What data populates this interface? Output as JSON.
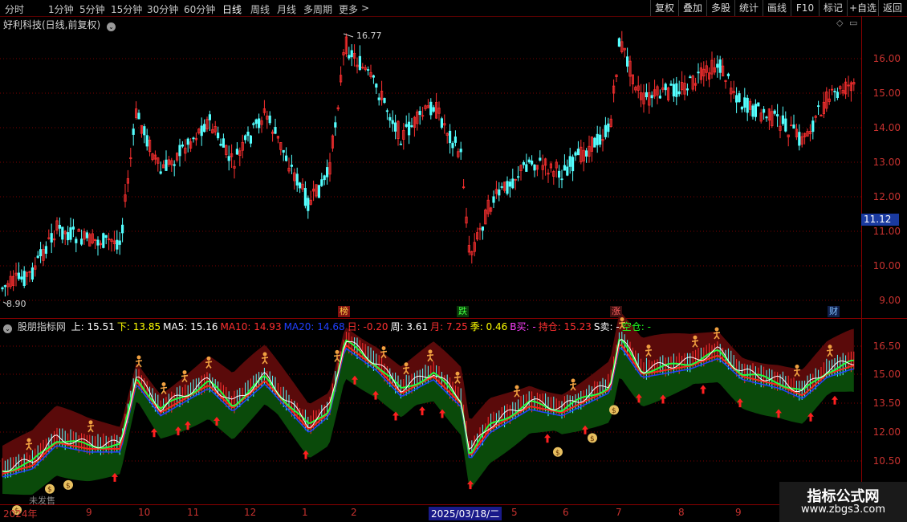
{
  "toolbar": {
    "periods": [
      "分时",
      "1分钟",
      "5分钟",
      "15分钟",
      "30分钟",
      "60分钟",
      "日线",
      "周线",
      "月线",
      "多周期",
      "更多"
    ],
    "active_period": "日线",
    "more_arrow": ">",
    "tools": [
      "复权",
      "叠加",
      "多股",
      "统计",
      "画线",
      "F10",
      "标记",
      "+自选",
      "返回"
    ]
  },
  "chart": {
    "title": "好利科技(日线,前复权)",
    "y_axis_ticks": [
      "16.00",
      "15.00",
      "14.00",
      "13.00",
      "12.00",
      "11.00",
      "10.00",
      "9.00"
    ],
    "current_price": "11.12",
    "high_label": "16.77",
    "low_label": "8.90",
    "event_markers": [
      "榜",
      "跌",
      "涨",
      "财"
    ]
  },
  "indicator": {
    "name": "股朋指标网",
    "values": [
      {
        "label": "上: ",
        "value": "15.51",
        "color": "#ffffff"
      },
      {
        "label": "下: ",
        "value": "13.85",
        "color": "#ffff00"
      },
      {
        "label": "MA5: ",
        "value": "15.16",
        "color": "#ffffff"
      },
      {
        "label": "MA10: ",
        "value": "14.93",
        "color": "#ff3030"
      },
      {
        "label": "MA20: ",
        "value": "14.68",
        "color": "#2040ff"
      },
      {
        "label": "日: ",
        "value": "-0.20",
        "color": "#ff3030"
      },
      {
        "label": "周: ",
        "value": "3.61",
        "color": "#ffffff"
      },
      {
        "label": "月: ",
        "value": "7.25",
        "color": "#ff3030"
      },
      {
        "label": "季: ",
        "value": "0.46",
        "color": "#ffff00"
      },
      {
        "label": "B买: ",
        "value": "-",
        "color": "#ff40ff"
      },
      {
        "label": "持仓: ",
        "value": "15.23",
        "color": "#ff3030"
      },
      {
        "label": "S卖: ",
        "value": "-",
        "color": "#ffffff"
      },
      {
        "label": "空仓: ",
        "value": "-",
        "color": "#20ff20"
      }
    ],
    "y_axis_ticks": [
      "16.50",
      "15.00",
      "13.50",
      "12.00",
      "10.50"
    ],
    "partial_label": "未发售"
  },
  "x_axis": {
    "labels": [
      "2024年",
      "9",
      "10",
      "11",
      "12",
      "1",
      "2",
      "2025/03/18/二",
      "5",
      "6",
      "7",
      "8",
      "9"
    ]
  },
  "watermark": {
    "line1": "指标公式网",
    "line2": "www.zbgs3.com"
  },
  "colors": {
    "up": "#ff3030",
    "down": "#54ffff",
    "grid": "#7a0000",
    "axis": "#c8322f"
  }
}
